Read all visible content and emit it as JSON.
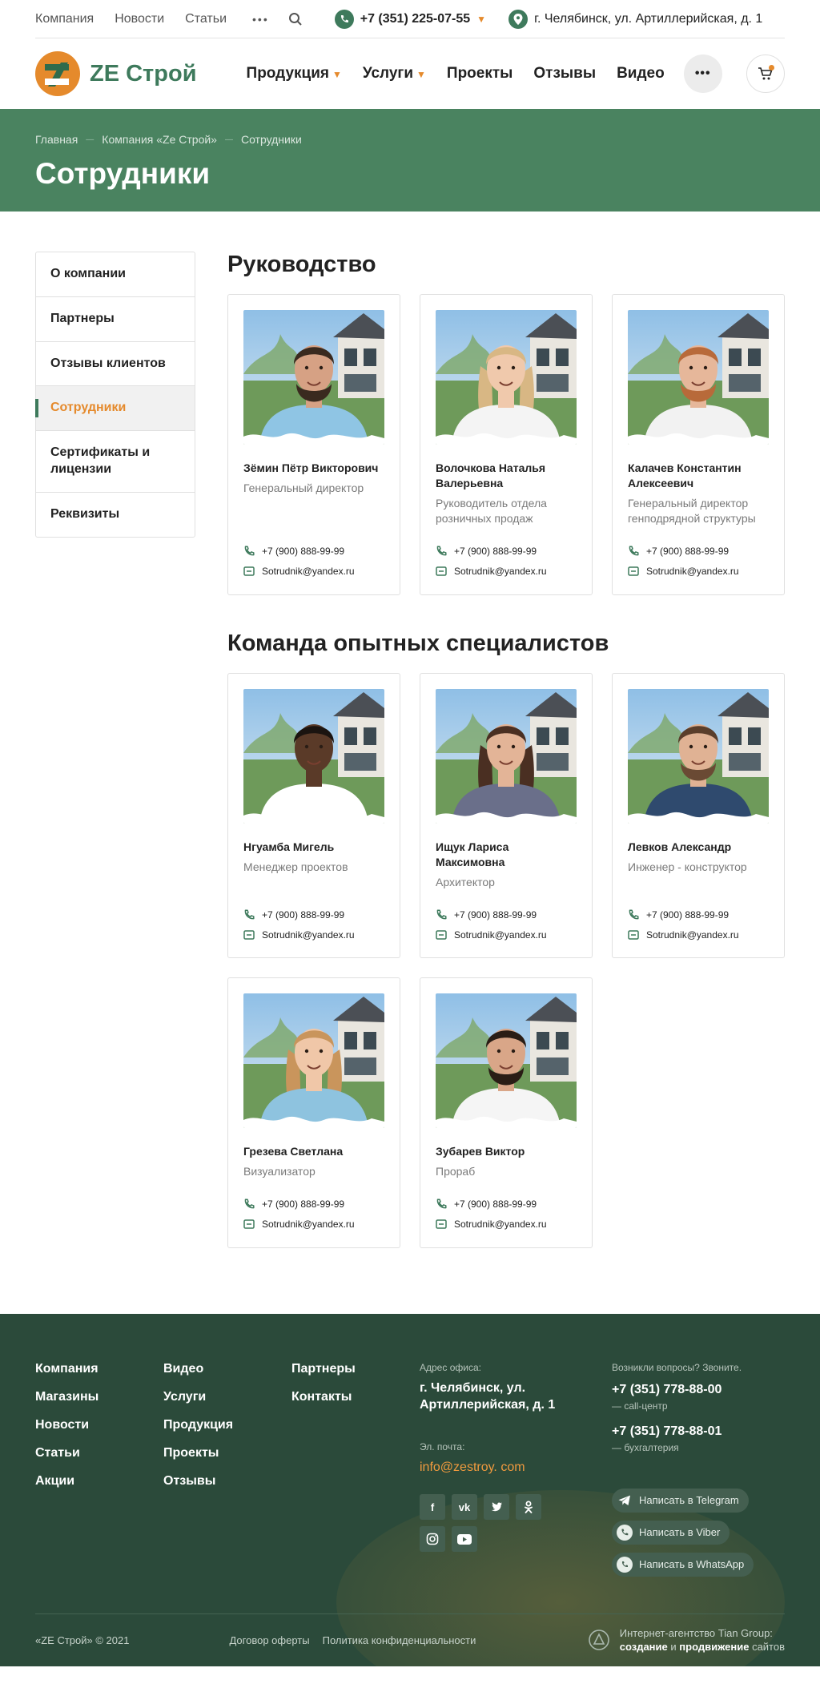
{
  "topbar": {
    "links": [
      "Компания",
      "Новости",
      "Статьи"
    ],
    "phone": "+7 (351) 225-07-55",
    "address": "г. Челябинск, ул. Артиллерийская, д. 1"
  },
  "header": {
    "logo_text": "ZE Строй",
    "nav": [
      {
        "label": "Продукция",
        "dropdown": true
      },
      {
        "label": "Услуги",
        "dropdown": true
      },
      {
        "label": "Проекты",
        "dropdown": false
      },
      {
        "label": "Отзывы",
        "dropdown": false
      },
      {
        "label": "Видео",
        "dropdown": false
      }
    ],
    "more_label": "•••"
  },
  "breadcrumb": [
    "Главная",
    "Компания «Ze Строй»",
    "Сотрудники"
  ],
  "page_title": "Сотрудники",
  "sidebar": {
    "items": [
      "О компании",
      "Партнеры",
      "Отзывы клиентов",
      "Сотрудники",
      "Сертификаты и лицензии",
      "Реквизиты"
    ],
    "active_index": 3
  },
  "sections": [
    {
      "title": "Руководство",
      "people": [
        {
          "name": "Зёмин Пётр Викторович",
          "role": "Генеральный директор",
          "phone": "+7 (900) 888-99-99",
          "email": "Sotrudnik@yandex.ru",
          "skin": "#d6a184",
          "hair": "#3a2a1f",
          "shirt": "#8fc5e4",
          "beard": true
        },
        {
          "name": "Волочкова Наталья Валерьевна",
          "role": "Руководитель отдела розничных продаж",
          "phone": "+7 (900) 888-99-99",
          "email": "Sotrudnik@yandex.ru",
          "skin": "#f0c9ac",
          "hair": "#d8b784",
          "shirt": "#f4f4f4",
          "beard": false,
          "long": true
        },
        {
          "name": "Калачев Константин Алексеевич",
          "role": "Генеральный директор генподрядной структуры",
          "phone": "+7 (900) 888-99-99",
          "email": "Sotrudnik@yandex.ru",
          "skin": "#e6b79a",
          "hair": "#b86a3a",
          "shirt": "#f2f2f2",
          "beard": true,
          "beardColor": "#b86a3a"
        }
      ]
    },
    {
      "title": "Команда опытных специалистов",
      "people": [
        {
          "name": "Нгуамба Мигель",
          "role": "Менеджер проектов",
          "phone": "+7 (900) 888-99-99",
          "email": "Sotrudnik@yandex.ru",
          "skin": "#5a3a28",
          "hair": "#1b1410",
          "shirt": "#ffffff",
          "beard": false
        },
        {
          "name": "Ищук Лариса Максимовна",
          "role": "Архитектор",
          "phone": "+7 (900) 888-99-99",
          "email": "Sotrudnik@yandex.ru",
          "skin": "#e3b497",
          "hair": "#4a2f22",
          "shirt": "#6a6f8a",
          "beard": false,
          "long": true
        },
        {
          "name": "Левков Александр",
          "role": "Инженер - конструктор",
          "phone": "+7 (900) 888-99-99",
          "email": "Sotrudnik@yandex.ru",
          "skin": "#e0b294",
          "hair": "#5a3e2b",
          "shirt": "#2f4a6e",
          "beard": true,
          "beardColor": "#6a4a34"
        },
        {
          "name": "Грезева Светлана",
          "role": "Визуализатор",
          "phone": "+7 (900) 888-99-99",
          "email": "Sotrudnik@yandex.ru",
          "skin": "#f0c7a8",
          "hair": "#c9955c",
          "shirt": "#8ec3df",
          "beard": false,
          "long": true
        },
        {
          "name": "Зубарев Виктор",
          "role": "Прораб",
          "phone": "+7 (900) 888-99-99",
          "email": "Sotrudnik@yandex.ru",
          "skin": "#d9a688",
          "hair": "#2a1d15",
          "shirt": "#f5f5f5",
          "beard": true,
          "beardColor": "#2a1d15"
        }
      ]
    }
  ],
  "footer": {
    "col1": [
      "Компания",
      "Магазины",
      "Новости",
      "Статьи",
      "Акции"
    ],
    "col2": [
      "Видео",
      "Услуги",
      "Продукция",
      "Проекты",
      "Отзывы"
    ],
    "col3": [
      "Партнеры",
      "Контакты"
    ],
    "address_label": "Адрес офиса:",
    "address": "г. Челябинск, ул. Артиллерийская, д. 1",
    "email_label": "Эл. почта:",
    "email": "info@zestroy. com",
    "socials": [
      "f",
      "vk",
      "tw",
      "ok",
      "ig",
      "yt"
    ],
    "questions_label": "Возникли вопросы? Звоните.",
    "phones": [
      {
        "number": "+7 (351) 778-88-00",
        "note": "— call-центр"
      },
      {
        "number": "+7 (351) 778-88-01",
        "note": "— бухгалтерия"
      }
    ],
    "messengers": [
      "Написать в Telegram",
      "Написать в Viber",
      "Написать в WhatsApp"
    ],
    "copyright": "«ZE Строй» © 2021",
    "legal": [
      "Договор оферты",
      "Политика конфиденциальности"
    ],
    "agency_line1": "Интернет-агентство Tian Group:",
    "agency_line2_a": "создание",
    "agency_line2_b": "и",
    "agency_line2_c": "продвижение",
    "agency_line2_d": "сайтов"
  },
  "colors": {
    "accent": "#e58a2c",
    "brand": "#3e7a5c",
    "hero": "#4a8360",
    "footer": "#2b4a3a"
  }
}
